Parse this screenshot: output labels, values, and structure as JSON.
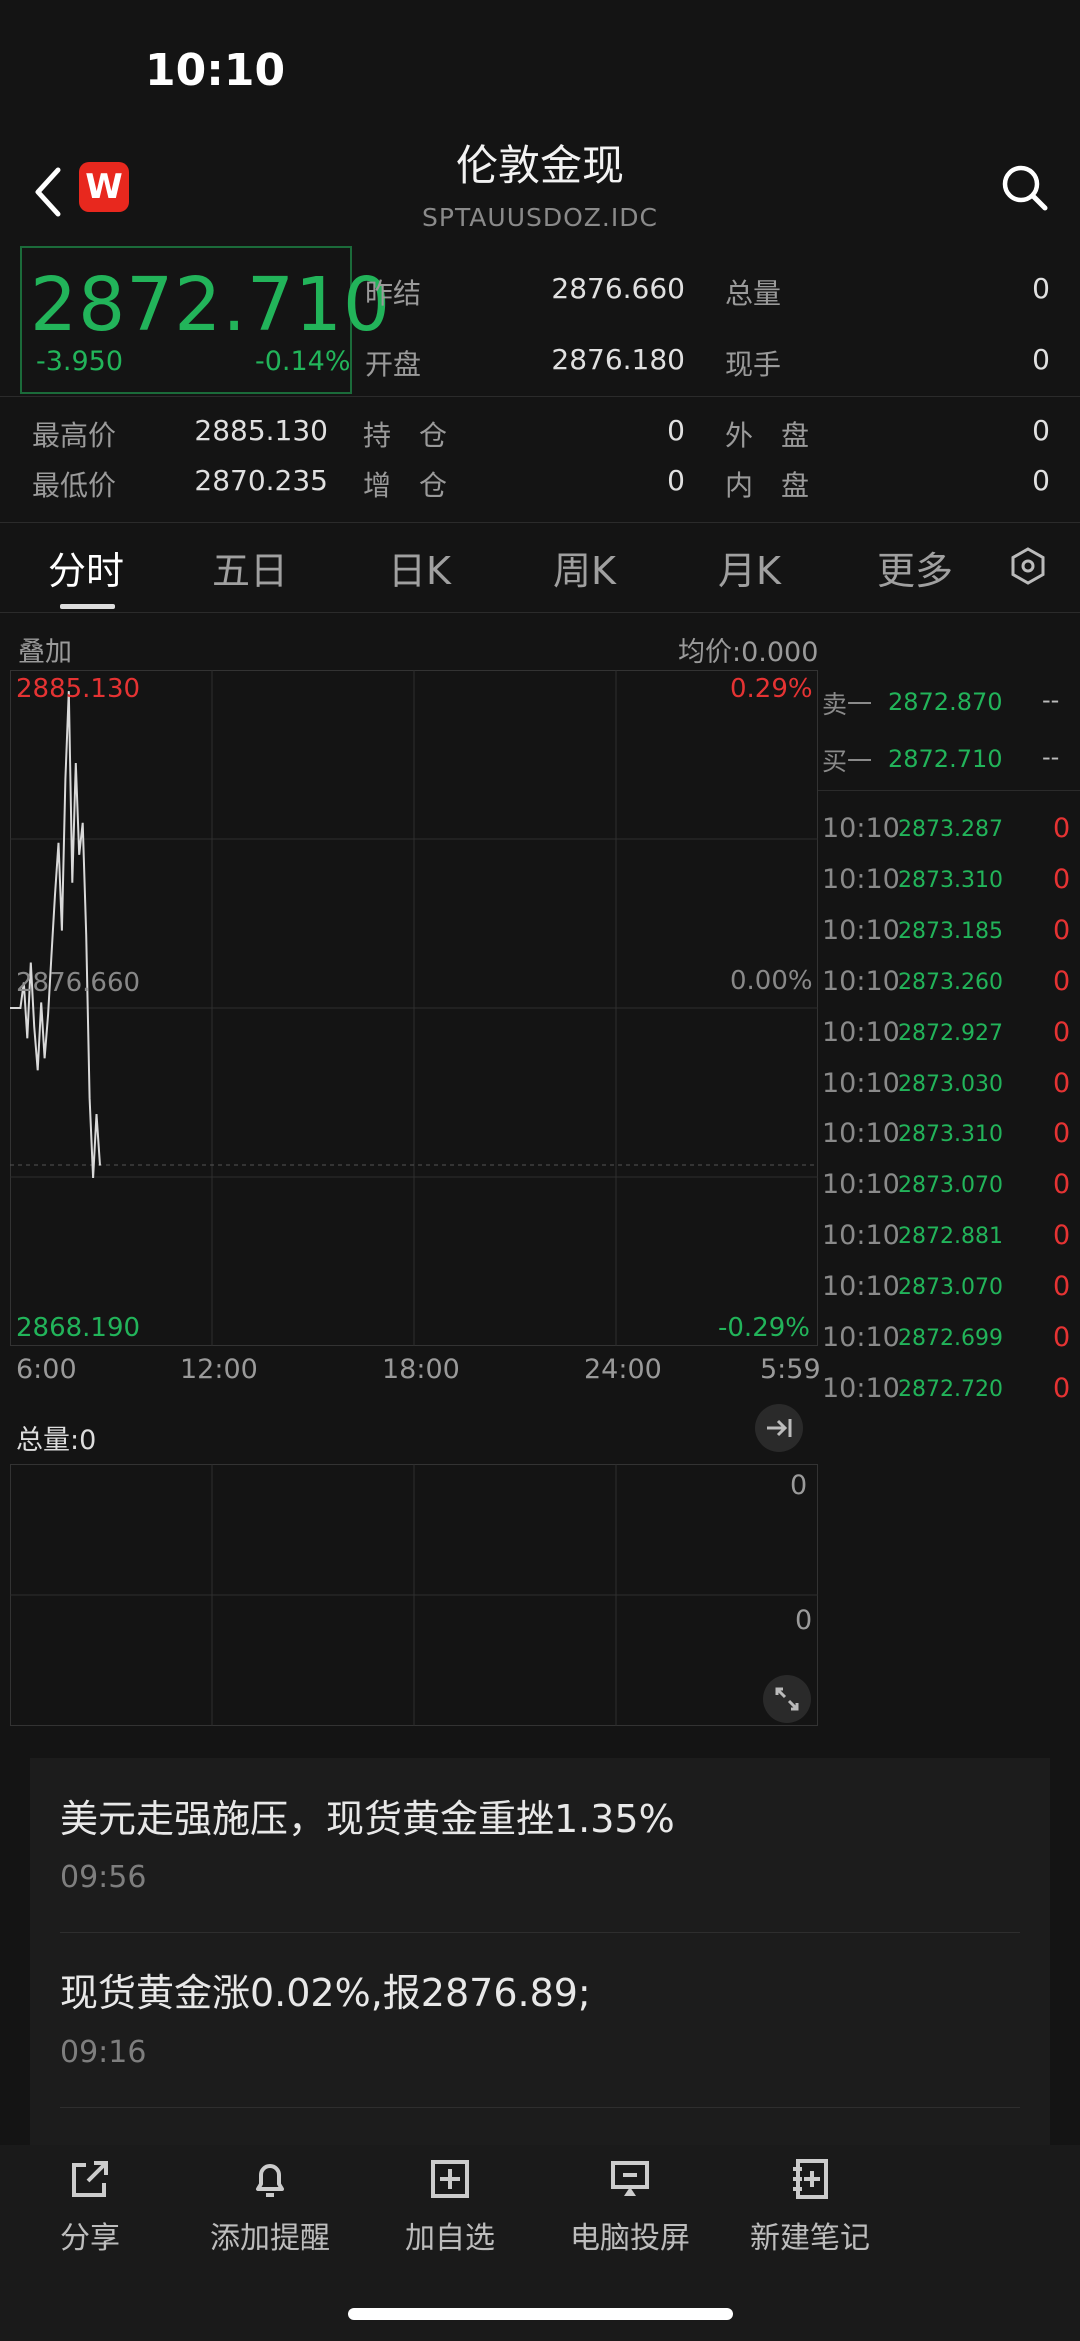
{
  "status": {
    "time": "10:10"
  },
  "header": {
    "title": "伦敦金现",
    "symbol": "SPTAUUSDOZ.IDC",
    "logo_letter": "W"
  },
  "quote": {
    "price": "2872.710",
    "change": "-3.950",
    "change_pct": "-0.14%",
    "fields": [
      {
        "label": "昨结",
        "value": "2876.660"
      },
      {
        "label": "总量",
        "value": "0"
      },
      {
        "label": "开盘",
        "value": "2876.180"
      },
      {
        "label": "现手",
        "value": "0"
      },
      {
        "label": "最高价",
        "value": "2885.130"
      },
      {
        "label": "持　仓",
        "value": "0"
      },
      {
        "label": "外　盘",
        "value": "0"
      },
      {
        "label": "最低价",
        "value": "2870.235"
      },
      {
        "label": "增　仓",
        "value": "0"
      },
      {
        "label": "内　盘",
        "value": "0"
      }
    ]
  },
  "tabs": [
    "分时",
    "五日",
    "日K",
    "周K",
    "月K",
    "更多"
  ],
  "chart": {
    "overlay_label": "叠加",
    "avg_label": "均价:0.000",
    "y_high": "2885.130",
    "y_mid": "2876.660",
    "y_low": "2868.190",
    "pct_high": "0.29%",
    "pct_mid": "0.00%",
    "pct_low": "-0.29%",
    "x_labels": [
      "6:00",
      "12:00",
      "18:00",
      "24:00",
      "5:59"
    ],
    "volume_label": "总量:0",
    "vol_axis_top": "0",
    "vol_axis_mid": "0"
  },
  "chart_data": {
    "type": "line",
    "xlabel": "",
    "ylabel": "",
    "ylim": [
      2868.19,
      2885.13
    ],
    "series": [
      {
        "values": [
          2876.66,
          2876.66,
          2876.66,
          2876.66,
          2877.3,
          2875.9,
          2877.8,
          2876.2,
          2875.1,
          2876.8,
          2875.4,
          2876.5,
          2878.0,
          2879.5,
          2880.8,
          2878.6,
          2882.4,
          2884.6,
          2879.8,
          2882.8,
          2880.5,
          2881.3,
          2878.5,
          2874.4,
          2872.4,
          2874.0,
          2872.71
        ]
      }
    ]
  },
  "order_book": {
    "sell_label": "卖一",
    "sell_price": "2872.870",
    "sell_vol": "--",
    "buy_label": "买一",
    "buy_price": "2872.710",
    "buy_vol": "--"
  },
  "trades": [
    {
      "time": "10:10",
      "price": "2873.287",
      "vol": "0"
    },
    {
      "time": "10:10",
      "price": "2873.310",
      "vol": "0"
    },
    {
      "time": "10:10",
      "price": "2873.185",
      "vol": "0"
    },
    {
      "time": "10:10",
      "price": "2873.260",
      "vol": "0"
    },
    {
      "time": "10:10",
      "price": "2872.927",
      "vol": "0"
    },
    {
      "time": "10:10",
      "price": "2873.030",
      "vol": "0"
    },
    {
      "time": "10:10",
      "price": "2873.310",
      "vol": "0"
    },
    {
      "time": "10:10",
      "price": "2873.070",
      "vol": "0"
    },
    {
      "time": "10:10",
      "price": "2872.881",
      "vol": "0"
    },
    {
      "time": "10:10",
      "price": "2873.070",
      "vol": "0"
    },
    {
      "time": "10:10",
      "price": "2872.699",
      "vol": "0"
    },
    {
      "time": "10:10",
      "price": "2872.720",
      "vol": "0"
    }
  ],
  "news": [
    {
      "title": "美元走强施压，现货黄金重挫1.35%",
      "time": "09:56"
    },
    {
      "title": "现货黄金涨0.02%,报2876.89;",
      "time": "09:16"
    }
  ],
  "bottom_bar": [
    "分享",
    "添加提醒",
    "加自选",
    "电脑投屏",
    "新建笔记"
  ],
  "colors": {
    "up": "#e53333",
    "down": "#22b45a",
    "bg": "#141414"
  }
}
